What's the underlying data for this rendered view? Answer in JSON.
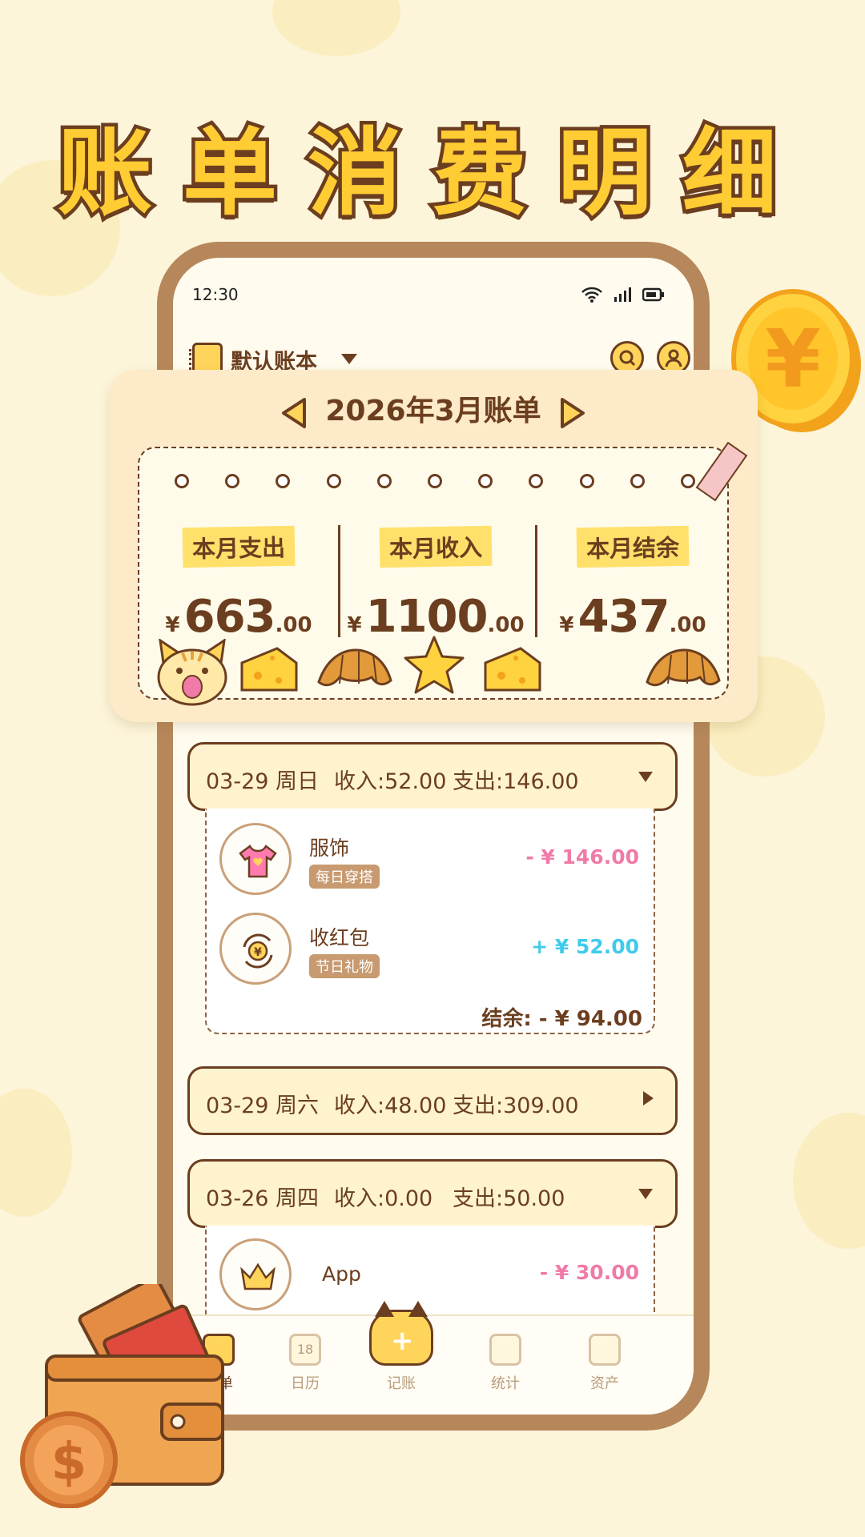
{
  "headline": "账单消费明细",
  "status_bar": {
    "time": "12:30"
  },
  "app_bar": {
    "ledger_name": "默认账本"
  },
  "summary": {
    "month_title": "2026年3月账单",
    "stats": [
      {
        "label": "本月支出",
        "currency": "¥",
        "integer": "663",
        "cents": ".00"
      },
      {
        "label": "本月收入",
        "currency": "¥",
        "integer": "1100",
        "cents": ".00"
      },
      {
        "label": "本月结余",
        "currency": "¥",
        "integer": "437",
        "cents": ".00"
      }
    ]
  },
  "days": [
    {
      "date": "03-29 周日",
      "income": "收入:52.00",
      "expense": "支出:146.00",
      "expanded": true,
      "items": [
        {
          "name": "服饰",
          "tag": "每日穿搭",
          "amount": "- ¥ 146.00",
          "icon": "tshirt-icon"
        },
        {
          "name": "收红包",
          "tag": "节日礼物",
          "amount": "+ ¥ 52.00",
          "icon": "yen-exchange-icon"
        }
      ],
      "balance": "结余: - ¥ 94.00"
    },
    {
      "date": "03-29 周六",
      "income": "收入:48.00",
      "expense": "支出:309.00",
      "expanded": false
    },
    {
      "date": "03-26 周四",
      "income": "收入:0.00",
      "expense": "支出:50.00",
      "expanded": true,
      "items": [
        {
          "name": "App",
          "amount": "- ¥ 30.00",
          "icon": "crown-icon"
        }
      ]
    }
  ],
  "tabbar": {
    "tabs": [
      {
        "label": "账单",
        "icon": "bill-icon",
        "active": true
      },
      {
        "label": "日历",
        "icon": "calendar-icon",
        "badge": "18"
      },
      {
        "label": "记账",
        "icon": "cat-add-icon"
      },
      {
        "label": "统计",
        "icon": "stats-icon"
      },
      {
        "label": "资产",
        "icon": "wallet-icon"
      }
    ]
  },
  "colors": {
    "brown": "#6B3E1F",
    "yellow": "#FFCC33",
    "expense_pink": "#F07AA8",
    "income_cyan": "#3FCBEA"
  }
}
